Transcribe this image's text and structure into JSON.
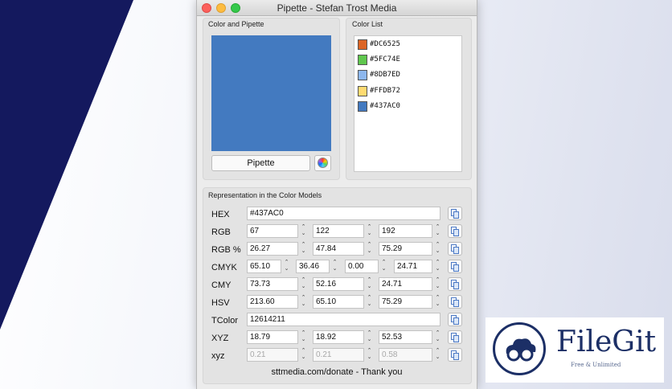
{
  "window": {
    "title": "Pipette - Stefan Trost Media"
  },
  "color_and_pipette": {
    "label": "Color and Pipette",
    "current_color": "#437AC0",
    "pipette_button": "Pipette",
    "wheel_icon": "color-wheel-icon"
  },
  "color_list": {
    "label": "Color List",
    "items": [
      {
        "hex": "#DC6525",
        "color": "#DC6525"
      },
      {
        "hex": "#5FC74E",
        "color": "#5FC74E"
      },
      {
        "hex": "#8DB7ED",
        "color": "#8DB7ED"
      },
      {
        "hex": "#FFDB72",
        "color": "#FFDB72"
      },
      {
        "hex": "#437AC0",
        "color": "#437AC0"
      }
    ]
  },
  "models": {
    "label": "Representation in the Color Models",
    "hex": {
      "label": "HEX",
      "value": "#437AC0"
    },
    "rgb": {
      "label": "RGB",
      "values": [
        "67",
        "122",
        "192"
      ]
    },
    "rgb_pct": {
      "label": "RGB %",
      "values": [
        "26.27",
        "47.84",
        "75.29"
      ]
    },
    "cmyk": {
      "label": "CMYK",
      "values": [
        "65.10",
        "36.46",
        "0.00",
        "24.71"
      ]
    },
    "cmy": {
      "label": "CMY",
      "values": [
        "73.73",
        "52.16",
        "24.71"
      ]
    },
    "hsv": {
      "label": "HSV",
      "values": [
        "213.60",
        "65.10",
        "75.29"
      ]
    },
    "tcolor": {
      "label": "TColor",
      "value": "12614211"
    },
    "xyz": {
      "label": "XYZ",
      "values": [
        "18.79",
        "18.92",
        "52.53"
      ]
    },
    "xyz_lower": {
      "label": "xyz",
      "values": [
        "0.21",
        "0.21",
        "0.58"
      ]
    },
    "copy_icon": "copy-icon"
  },
  "footer": {
    "donate": "sttmedia.com/donate - Thank you"
  },
  "watermark": {
    "brand": "FileGit",
    "tagline": "Free & Unlimited",
    "logo_icon": "cloud-binoculars-logo-icon"
  }
}
